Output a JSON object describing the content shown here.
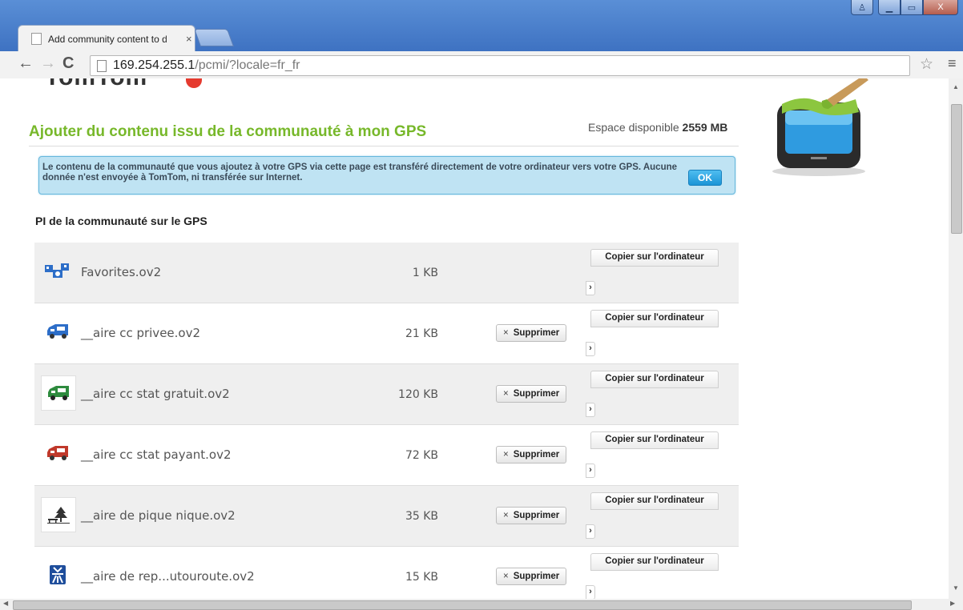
{
  "browser": {
    "tab_title": "Add community content to d",
    "tab_close": "×",
    "url_host": "169.254.255.1",
    "url_path": "/pcmi/?locale=fr_fr",
    "back_glyph": "←",
    "forward_glyph": "→",
    "reload_glyph": "C",
    "star_glyph": "☆",
    "menu_glyph": "≡",
    "window_controls": {
      "user": "♙",
      "minimize": "▁",
      "maximize": "▭",
      "close": "X"
    }
  },
  "page": {
    "logo_text": "TomTom",
    "heading": "Ajouter du contenu issu de la communauté à mon GPS",
    "space_label": "Espace disponible",
    "space_value": "2559 MB",
    "notice_text": "Le contenu de la communauté que vous ajoutez à votre GPS via cette page est transféré directement de votre ordinateur vers votre GPS. Aucune donnée n'est envoyée à TomTom, ni transférée sur Internet.",
    "ok_label": "OK",
    "section_title": "PI de la communauté sur le GPS",
    "copy_label": "Copier sur l'ordinateur",
    "delete_label": "Supprimer",
    "delete_glyph": "×",
    "more_glyph": "›"
  },
  "files": [
    {
      "name": "Favorites.ov2",
      "size": "1 KB",
      "icon": "favorites-icon",
      "deletable": false
    },
    {
      "name": "__aire cc privee.ov2",
      "size": "21 KB",
      "icon": "camper-blue-icon",
      "deletable": true
    },
    {
      "name": "__aire cc stat gratuit.ov2",
      "size": "120 KB",
      "icon": "camper-green-icon",
      "deletable": true
    },
    {
      "name": "__aire cc stat payant.ov2",
      "size": "72 KB",
      "icon": "camper-red-icon",
      "deletable": true
    },
    {
      "name": "__aire de pique nique.ov2",
      "size": "35 KB",
      "icon": "picnic-tree-icon",
      "deletable": true
    },
    {
      "name": "__aire de rep...utouroute.ov2",
      "size": "15 KB",
      "icon": "motorway-rest-icon",
      "deletable": true
    }
  ],
  "colors": {
    "heading_green": "#77b82a",
    "notice_bg": "#bfe3f3",
    "ok_blue": "#1b94d6",
    "titlebar_blue": "#4a7fcb"
  }
}
